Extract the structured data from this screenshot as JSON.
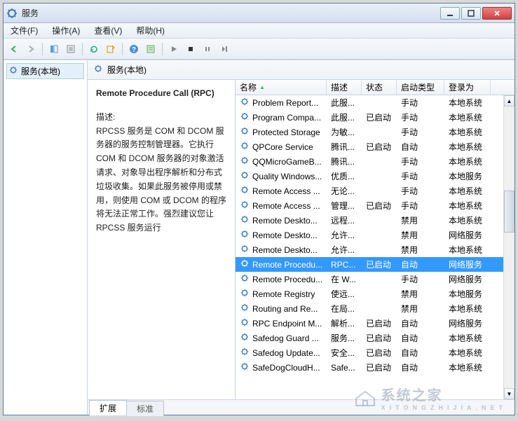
{
  "window": {
    "title": "服务"
  },
  "menu": {
    "file": "文件(F)",
    "action": "操作(A)",
    "view": "查看(V)",
    "help": "帮助(H)"
  },
  "tree": {
    "root": "服务(本地)"
  },
  "pane": {
    "header": "服务(本地)"
  },
  "desc": {
    "title": "Remote Procedure Call (RPC)",
    "label": "描述:",
    "body": "RPCSS 服务是 COM 和 DCOM 服务器的服务控制管理器。它执行 COM 和 DCOM 服务器的对象激活请求、对象导出程序解析和分布式垃圾收集。如果此服务被停用或禁用，则使用 COM 或 DCOM 的程序将无法正常工作。强烈建议您让 RPCSS 服务运行"
  },
  "columns": {
    "name": "名称",
    "desc": "描述",
    "status": "状态",
    "startup": "启动类型",
    "logon": "登录为"
  },
  "rows": [
    {
      "name": "Problem Report...",
      "desc": "此服...",
      "status": "",
      "startup": "手动",
      "logon": "本地系统"
    },
    {
      "name": "Program Compa...",
      "desc": "此服...",
      "status": "已启动",
      "startup": "手动",
      "logon": "本地系统"
    },
    {
      "name": "Protected Storage",
      "desc": "为敏...",
      "status": "",
      "startup": "手动",
      "logon": "本地系统"
    },
    {
      "name": "QPCore Service",
      "desc": "腾讯...",
      "status": "已启动",
      "startup": "自动",
      "logon": "本地系统"
    },
    {
      "name": "QQMicroGameB...",
      "desc": "腾讯...",
      "status": "",
      "startup": "手动",
      "logon": "本地系统"
    },
    {
      "name": "Quality Windows...",
      "desc": "优质...",
      "status": "",
      "startup": "手动",
      "logon": "本地服务"
    },
    {
      "name": "Remote Access ...",
      "desc": "无论...",
      "status": "",
      "startup": "手动",
      "logon": "本地系统"
    },
    {
      "name": "Remote Access ...",
      "desc": "管理...",
      "status": "已启动",
      "startup": "手动",
      "logon": "本地系统"
    },
    {
      "name": "Remote Deskto...",
      "desc": "远程...",
      "status": "",
      "startup": "禁用",
      "logon": "本地系统"
    },
    {
      "name": "Remote Deskto...",
      "desc": "允许...",
      "status": "",
      "startup": "禁用",
      "logon": "网络服务"
    },
    {
      "name": "Remote Deskto...",
      "desc": "允许...",
      "status": "",
      "startup": "禁用",
      "logon": "本地系统"
    },
    {
      "name": "Remote Procedu...",
      "desc": "RPC...",
      "status": "已启动",
      "startup": "自动",
      "logon": "网络服务",
      "selected": true
    },
    {
      "name": "Remote Procedu...",
      "desc": "在 W...",
      "status": "",
      "startup": "手动",
      "logon": "网络服务"
    },
    {
      "name": "Remote Registry",
      "desc": "使远...",
      "status": "",
      "startup": "禁用",
      "logon": "本地服务"
    },
    {
      "name": "Routing and Re...",
      "desc": "在局...",
      "status": "",
      "startup": "禁用",
      "logon": "本地系统"
    },
    {
      "name": "RPC Endpoint M...",
      "desc": "解析...",
      "status": "已启动",
      "startup": "自动",
      "logon": "网络服务"
    },
    {
      "name": "Safedog Guard ...",
      "desc": "服务...",
      "status": "已启动",
      "startup": "自动",
      "logon": "本地系统"
    },
    {
      "name": "Safedog Update...",
      "desc": "安全...",
      "status": "已启动",
      "startup": "自动",
      "logon": "本地系统"
    },
    {
      "name": "SafeDogCloudH...",
      "desc": "Safe...",
      "status": "已启动",
      "startup": "自动",
      "logon": "本地系统"
    }
  ],
  "tabs": {
    "extended": "扩展",
    "standard": "标准"
  },
  "watermark": {
    "main": "系统之家",
    "sub": "XITONGZHIJIA.NET"
  }
}
